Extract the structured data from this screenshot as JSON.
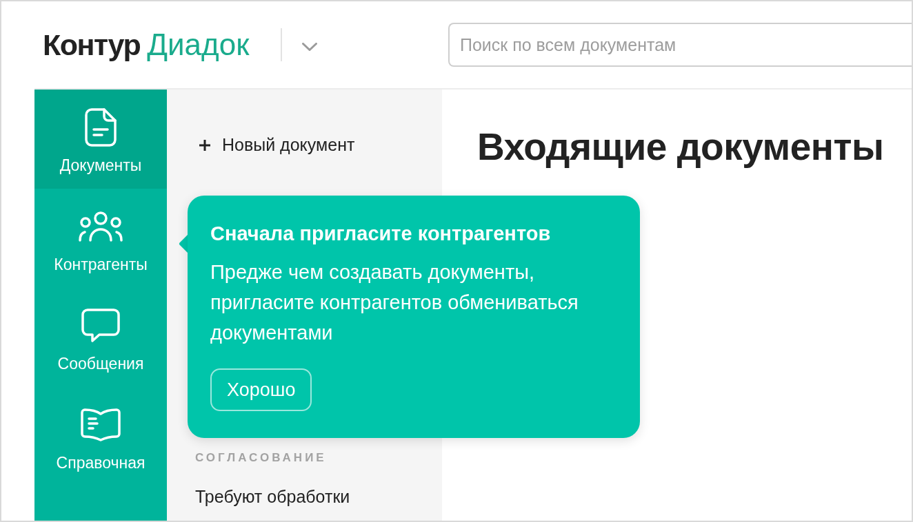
{
  "header": {
    "logo": {
      "brand": "Контур",
      "product": "Диадок"
    },
    "search": {
      "placeholder": "Поиск по всем документам"
    }
  },
  "sidebar": {
    "items": [
      {
        "label": "Документы",
        "selected": true
      },
      {
        "label": "Контрагенты",
        "selected": false
      },
      {
        "label": "Сообщения",
        "selected": false
      },
      {
        "label": "Справочная",
        "selected": false
      }
    ]
  },
  "nav_panel": {
    "new_document": {
      "label": "Новый документ"
    },
    "sections": [
      {
        "heading": "СОГЛАСОВАНИЕ",
        "items": [
          {
            "label": "Требуют обработки"
          }
        ]
      }
    ]
  },
  "main": {
    "title": "Входящие документы"
  },
  "popover": {
    "title": "Сначала пригласите контрагентов",
    "text": "Предже чем создавать документы, пригласите контрагентов обмениваться документами",
    "button": "Хорошо"
  }
}
